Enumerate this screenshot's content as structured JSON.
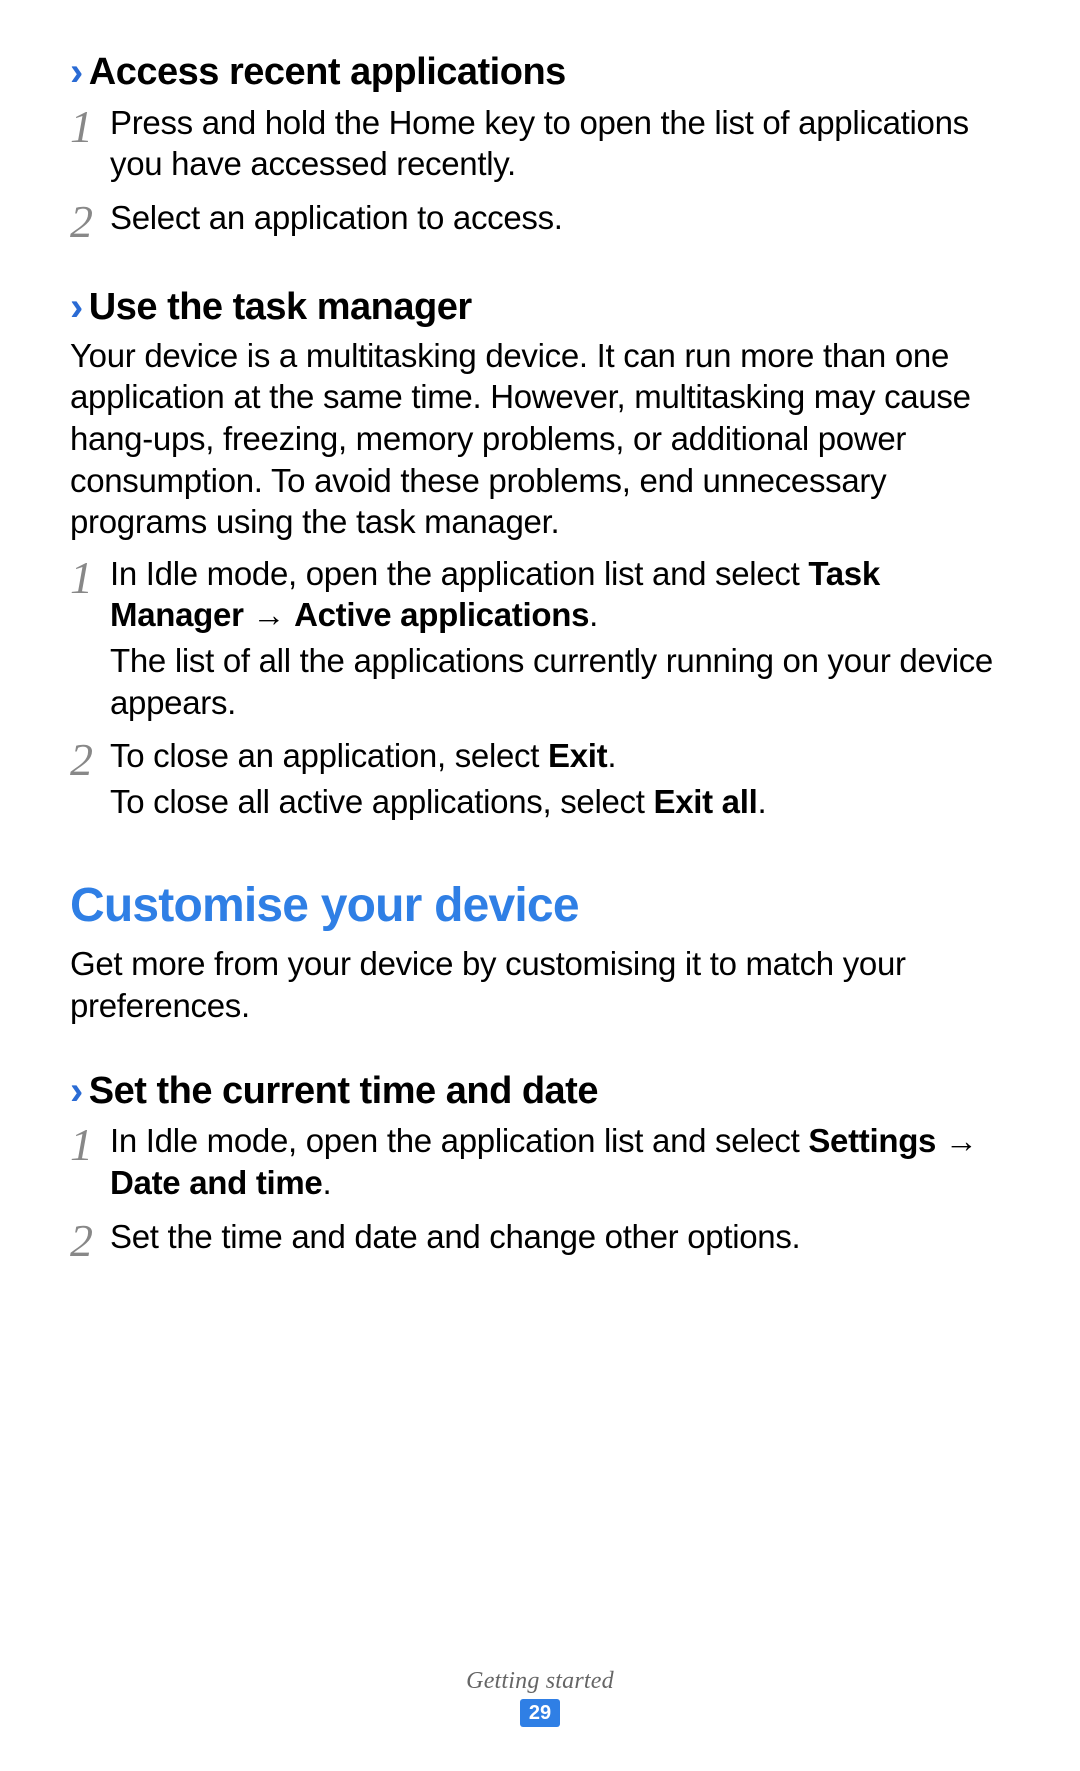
{
  "glyphs": {
    "chevron": "›",
    "arrow": "→"
  },
  "sections": [
    {
      "heading": "Access recent applications",
      "steps": [
        {
          "num": "1",
          "lines": [
            "Press and hold the Home key to open the list of applications you have accessed recently."
          ]
        },
        {
          "num": "2",
          "lines": [
            "Select an application to access."
          ]
        }
      ]
    },
    {
      "heading": "Use the task manager",
      "intro": "Your device is a multitasking device. It can run more than one application at the same time. However, multitasking may cause hang-ups, freezing, memory problems, or additional power consumption. To avoid these problems, end unnecessary programs using the task manager.",
      "steps": [
        {
          "num": "1",
          "line1_pre": "In Idle mode, open the application list and select ",
          "line1_b1": "Task Manager",
          "line1_mid": " ",
          "line1_b2": "Active applications",
          "line1_post": ".",
          "line2": "The list of all the applications currently running on your device appears."
        },
        {
          "num": "2",
          "line1_pre": "To close an application, select ",
          "line1_b1": "Exit",
          "line1_post1": ".",
          "line2_pre": "To close all active applications, select ",
          "line2_b1": "Exit all",
          "line2_post": "."
        }
      ]
    }
  ],
  "bigHeading": "Customise your device",
  "bigIntro": "Get more from your device by customising it to match your preferences.",
  "section3": {
    "heading": "Set the current time and date",
    "steps": [
      {
        "num": "1",
        "pre": "In Idle mode, open the application list and select ",
        "b1": "Settings",
        "mid": " ",
        "b2": "Date and time",
        "post": "."
      },
      {
        "num": "2",
        "text": "Set the time and date and change other options."
      }
    ]
  },
  "footer": {
    "label": "Getting started",
    "page": "29"
  }
}
